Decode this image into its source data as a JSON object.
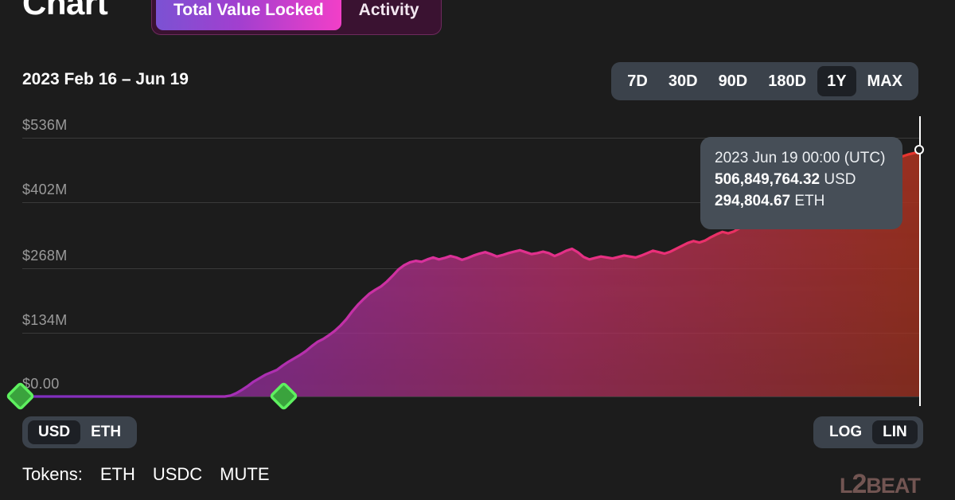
{
  "header": {
    "title": "Chart",
    "tabs": [
      {
        "label": "Total Value Locked",
        "active": true
      },
      {
        "label": "Activity",
        "active": false
      }
    ]
  },
  "toolbar": {
    "date_range": "2023 Feb 16 – Jun 19",
    "ranges": [
      {
        "label": "7D",
        "active": false
      },
      {
        "label": "30D",
        "active": false
      },
      {
        "label": "90D",
        "active": false
      },
      {
        "label": "180D",
        "active": false
      },
      {
        "label": "1Y",
        "active": true
      },
      {
        "label": "MAX",
        "active": false
      }
    ]
  },
  "tooltip": {
    "date": "2023 Jun 19 00:00 (UTC)",
    "usd_value": "506,849,764.32",
    "usd_unit": "USD",
    "eth_value": "294,804.67",
    "eth_unit": "ETH"
  },
  "watermark": {
    "pre": "L",
    "big": "2",
    "post": "BEAT"
  },
  "footer": {
    "units": [
      {
        "label": "USD",
        "active": true
      },
      {
        "label": "ETH",
        "active": false
      }
    ],
    "scales": [
      {
        "label": "LOG",
        "active": false
      },
      {
        "label": "LIN",
        "active": true
      }
    ],
    "tokens_label": "Tokens:",
    "tokens": [
      "ETH",
      "USDC",
      "MUTE"
    ]
  },
  "colors": {
    "background": "#1c1c1c",
    "gridline": "#3a3a3a",
    "line_start": "#8b34c4",
    "line_mid": "#e8338f",
    "line_end": "#e8352c",
    "marker_green": "#4ade50",
    "crosshair": "#ffffff",
    "tab_gradient_start": "#7b52d3",
    "tab_gradient_end": "#f23fc8",
    "tooltip_bg": "#464e57"
  },
  "chart_data": {
    "type": "area",
    "title": "Total Value Locked",
    "xlabel": "",
    "ylabel": "USD",
    "grid": true,
    "legend": "none",
    "ylim": [
      0,
      536000000
    ],
    "ytick_labels": [
      "$536M",
      "$402M",
      "$268M",
      "$134M",
      "$0.00"
    ],
    "ytick_values": [
      536000000,
      402000000,
      268000000,
      134000000,
      0
    ],
    "x_start": "2023 Feb 16",
    "x_end": "2023 Jun 19",
    "markers": [
      {
        "type": "milestone-diamond",
        "color": "#4ade50",
        "x_frac": 0.0,
        "value": 0
      },
      {
        "type": "milestone-diamond",
        "color": "#4ade50",
        "x_frac": 0.292,
        "value": 0
      }
    ],
    "hover_point": {
      "date": "2023 Jun 19 00:00 (UTC)",
      "usd": 506849764.32,
      "eth": 294804.67
    },
    "values": [
      0,
      0,
      0,
      0,
      0,
      0,
      0,
      0,
      0,
      0,
      0,
      0,
      0,
      0,
      0,
      0,
      0,
      0,
      0,
      0,
      0,
      0,
      0,
      0,
      0,
      0,
      0,
      0,
      0,
      0,
      0,
      0,
      0,
      0,
      0,
      0,
      2000000,
      7000000,
      14000000,
      22000000,
      31000000,
      38000000,
      45000000,
      50000000,
      55000000,
      64000000,
      72000000,
      79000000,
      86000000,
      94000000,
      104000000,
      113000000,
      119000000,
      127000000,
      136000000,
      147000000,
      160000000,
      176000000,
      190000000,
      202000000,
      213000000,
      221000000,
      228000000,
      238000000,
      250000000,
      263000000,
      272000000,
      278000000,
      281000000,
      279000000,
      284000000,
      288000000,
      284000000,
      287000000,
      291000000,
      288000000,
      283000000,
      287000000,
      292000000,
      296000000,
      299000000,
      295000000,
      290000000,
      293000000,
      297000000,
      300000000,
      303000000,
      299000000,
      295000000,
      297000000,
      300000000,
      297000000,
      291000000,
      296000000,
      302000000,
      306000000,
      299000000,
      289000000,
      284000000,
      287000000,
      290000000,
      288000000,
      286000000,
      289000000,
      292000000,
      290000000,
      288000000,
      292000000,
      297000000,
      302000000,
      299000000,
      296000000,
      300000000,
      306000000,
      312000000,
      318000000,
      322000000,
      319000000,
      323000000,
      330000000,
      336000000,
      341000000,
      338000000,
      342000000,
      349000000,
      356000000,
      362000000,
      367000000,
      372000000,
      369000000,
      374000000,
      382000000,
      390000000,
      397000000,
      402000000,
      399000000,
      404000000,
      412000000,
      421000000,
      428000000,
      432000000,
      436000000,
      441000000,
      447000000,
      454000000,
      461000000,
      467000000,
      472000000,
      477000000,
      481000000,
      486000000,
      492000000,
      497000000,
      501000000,
      504000000,
      506849764
    ]
  }
}
